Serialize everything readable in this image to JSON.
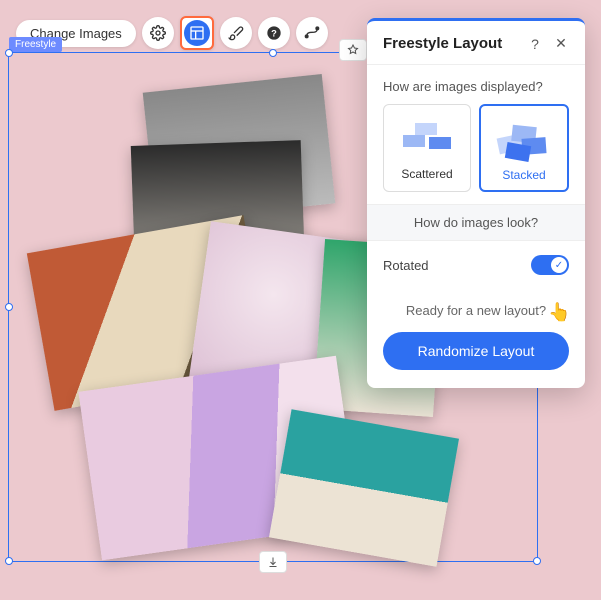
{
  "toolbar": {
    "change_images_label": "Change Images"
  },
  "selection": {
    "tag": "Freestyle"
  },
  "panel": {
    "title": "Freestyle Layout",
    "section_display": "How are images displayed?",
    "option_scattered": "Scattered",
    "option_stacked": "Stacked",
    "section_look": "How do images look?",
    "rotated_label": "Rotated",
    "rotated_on": true,
    "ready_label": "Ready for a new layout?",
    "randomize_label": "Randomize Layout"
  },
  "colors": {
    "accent": "#2e6ff2",
    "highlight": "#ff6a3d",
    "bg": "#ecc9ce"
  }
}
